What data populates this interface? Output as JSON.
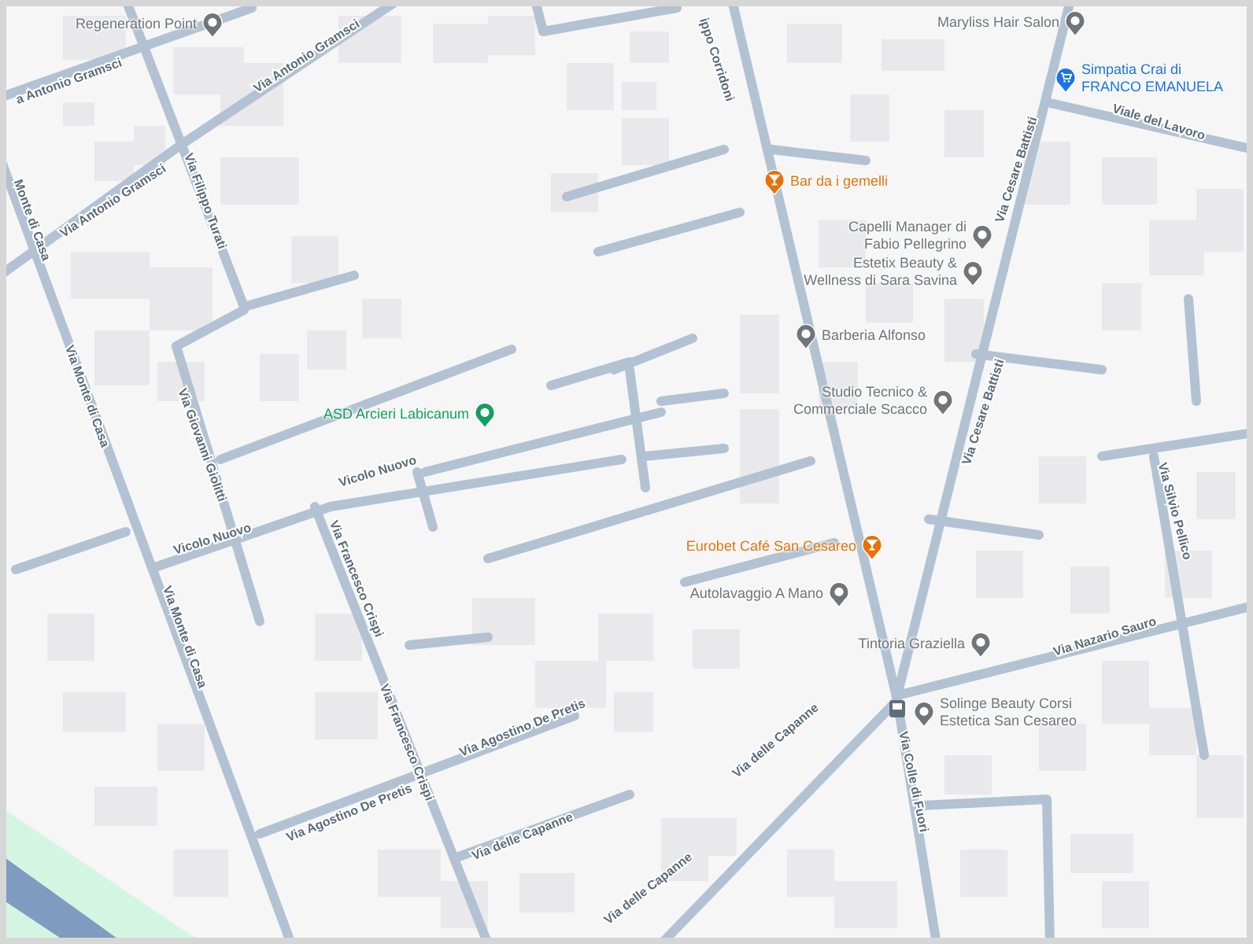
{
  "map": {
    "street_labels": [
      "a Antonio Gramsci",
      "Via Antonio Gramsci",
      "Via Antonio Gramsci",
      "Monte di Casa",
      "Via Monte di Casa",
      "Via Monte di Casa",
      "Via Filippo Turati",
      "Via Giovanni Giolitti",
      "Vicolo Nuovo",
      "Vicolo Nuovo",
      "Via Francesco Crispi",
      "Via Francesco Crispi",
      "Via Agostino De Pretis",
      "Via Agostino De Pretis",
      "Via delle Capanne",
      "Via delle Capanne",
      "Via delle Capanne",
      "ippo Corridoni",
      "Via Cesare Battisti",
      "Via Cesare Battisti",
      "Viale del Lavoro",
      "Via Nazario Sauro",
      "Via Silvio Pellico",
      "Via Colle di Fuori"
    ],
    "places": [
      {
        "name": [
          "Regeneration Point"
        ],
        "kind": "pin",
        "color": "#70757a"
      },
      {
        "name": [
          "Maryliss Hair Salon"
        ],
        "kind": "pin",
        "color": "#70757a"
      },
      {
        "name": [
          "Simpatia Crai di",
          "FRANCO EMANUELA"
        ],
        "kind": "shop",
        "color": "#1a73e8"
      },
      {
        "name": [
          "Bar da i gemelli"
        ],
        "kind": "bar",
        "color": "#e8710a"
      },
      {
        "name": [
          "Capelli Manager di",
          "Fabio Pellegrino"
        ],
        "kind": "pin",
        "color": "#70757a"
      },
      {
        "name": [
          "Estetix Beauty &",
          "Wellness di Sara Savina"
        ],
        "kind": "pin",
        "color": "#70757a"
      },
      {
        "name": [
          "Barberia Alfonso"
        ],
        "kind": "pin",
        "color": "#70757a"
      },
      {
        "name": [
          "ASD Arcieri Labicanum"
        ],
        "kind": "pin",
        "color": "#12a05c"
      },
      {
        "name": [
          "Studio Tecnico &",
          "Commerciale Scacco"
        ],
        "kind": "pin",
        "color": "#70757a"
      },
      {
        "name": [
          "Eurobet Café San Cesareo"
        ],
        "kind": "bar",
        "color": "#e8710a"
      },
      {
        "name": [
          "Autolavaggio A Mano"
        ],
        "kind": "pin",
        "color": "#70757a"
      },
      {
        "name": [
          "Tintoria Graziella"
        ],
        "kind": "pin",
        "color": "#70757a"
      },
      {
        "name": [
          "Solinge Beauty Corsi",
          "Estetica San Cesareo"
        ],
        "kind": "pin",
        "color": "#70757a"
      }
    ]
  }
}
